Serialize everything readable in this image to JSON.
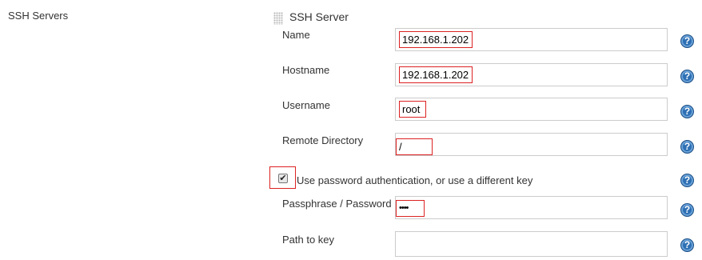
{
  "section": {
    "label": "SSH Servers"
  },
  "server": {
    "title": "SSH Server",
    "fields": {
      "name": {
        "label": "Name",
        "value": "192.168.1.202"
      },
      "hostname": {
        "label": "Hostname",
        "value": "192.168.1.202"
      },
      "username": {
        "label": "Username",
        "value": "root"
      },
      "remote_directory": {
        "label": "Remote Directory",
        "value": "/"
      },
      "passphrase": {
        "label": "Passphrase / Password",
        "value": "••••"
      },
      "path_to_key": {
        "label": "Path to key",
        "value": ""
      }
    },
    "use_password_auth": {
      "label": "Use password authentication, or use a different key",
      "checked": true
    }
  },
  "icons": {
    "help": "help-circle-icon",
    "check": "checkmark-icon",
    "drag": "drag-handle-icon"
  },
  "colors": {
    "help_blue": "#2d6fb4",
    "highlight_red": "#dd2222"
  }
}
